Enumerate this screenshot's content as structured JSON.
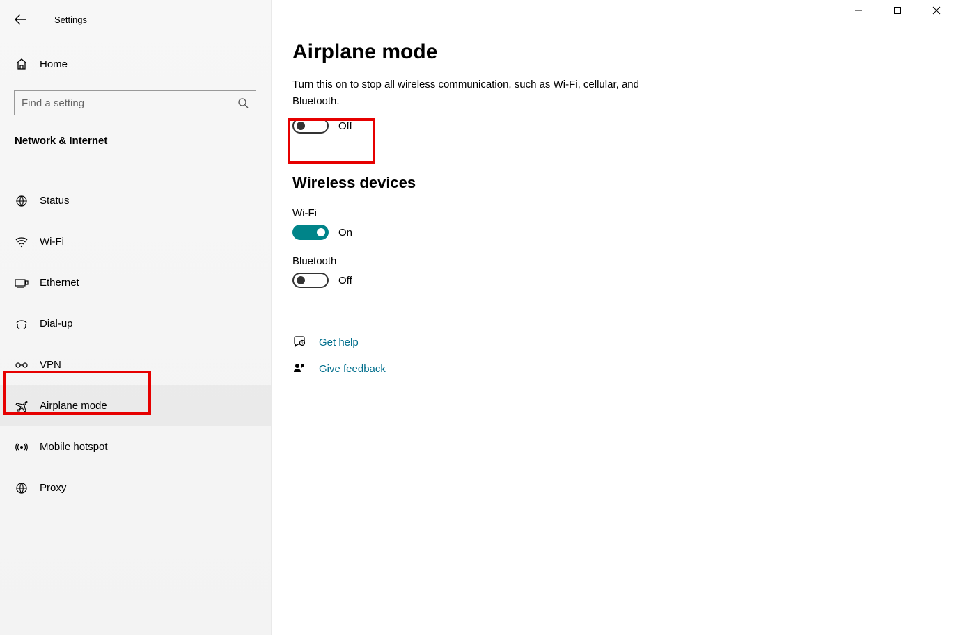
{
  "window": {
    "title": "Settings"
  },
  "sidebar": {
    "home": "Home",
    "searchPlaceholder": "Find a setting",
    "category": "Network & Internet",
    "items": [
      {
        "label": "Status",
        "icon": "status-icon"
      },
      {
        "label": "Wi-Fi",
        "icon": "wifi-icon"
      },
      {
        "label": "Ethernet",
        "icon": "ethernet-icon"
      },
      {
        "label": "Dial-up",
        "icon": "dialup-icon"
      },
      {
        "label": "VPN",
        "icon": "vpn-icon"
      },
      {
        "label": "Airplane mode",
        "icon": "airplane-icon"
      },
      {
        "label": "Mobile hotspot",
        "icon": "hotspot-icon"
      },
      {
        "label": "Proxy",
        "icon": "proxy-icon"
      }
    ]
  },
  "main": {
    "title": "Airplane mode",
    "description": "Turn this on to stop all wireless communication, such as Wi-Fi, cellular, and Bluetooth.",
    "airplaneToggleState": "Off",
    "wirelessHeading": "Wireless devices",
    "wifiLabel": "Wi-Fi",
    "wifiToggleState": "On",
    "bluetoothLabel": "Bluetooth",
    "bluetoothToggleState": "Off",
    "getHelp": "Get help",
    "giveFeedback": "Give feedback"
  }
}
